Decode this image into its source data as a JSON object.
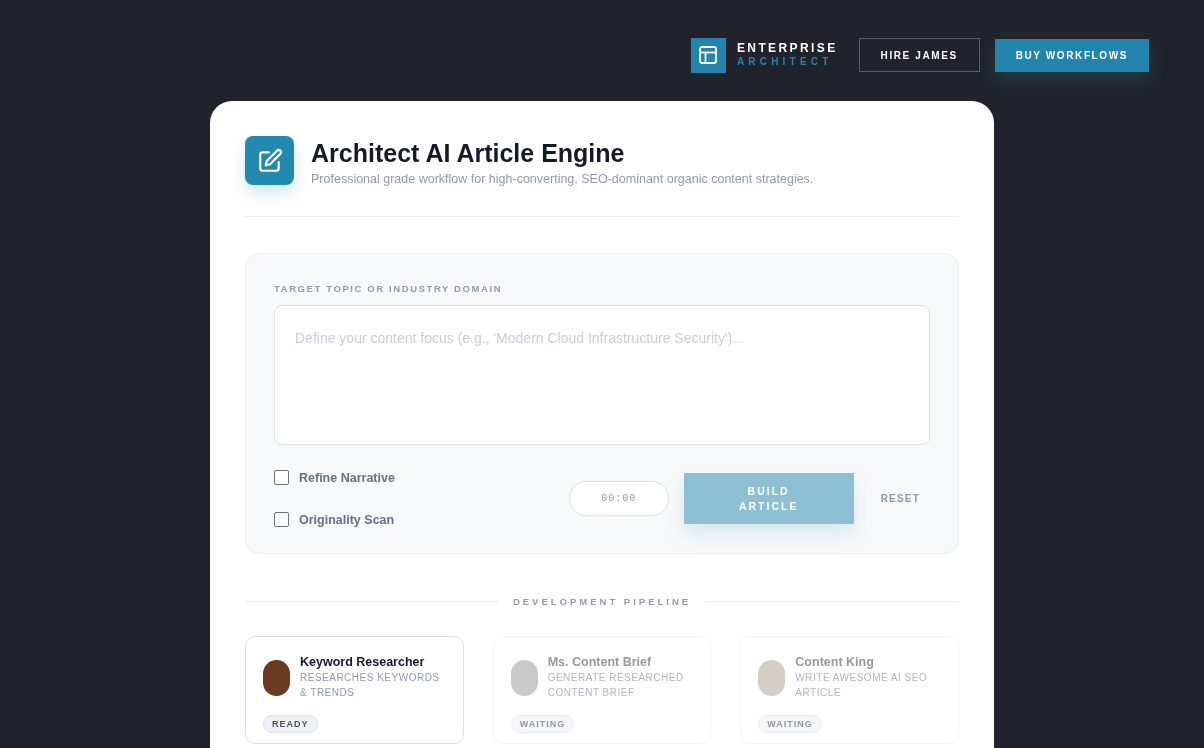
{
  "brand": {
    "title": "ENTERPRISE",
    "subtitle": "ARCHITECT"
  },
  "nav_buttons": [
    {
      "label": "HIRE JAMES",
      "kind": "outline"
    },
    {
      "label": "BUY WORKFLOWS",
      "kind": "primary"
    }
  ],
  "header": {
    "title": "Architect AI Article Engine",
    "subtitle": "Professional grade workflow for high-converting, SEO-dominant organic content strategies."
  },
  "form": {
    "label": "TARGET TOPIC OR INDUSTRY DOMAIN",
    "placeholder": "Define your content focus (e.g., 'Modern Cloud Infrastructure Security')...",
    "options": [
      {
        "label": "Refine Narrative",
        "checked": false
      },
      {
        "label": "Originality Scan",
        "checked": false
      }
    ],
    "timer": "00:00",
    "build_button": {
      "label": "BUILD ARTICLE",
      "disabled": true
    },
    "reset_label": "RESET"
  },
  "pipeline": {
    "title": "DEVELOPMENT PIPELINE",
    "agents": [
      {
        "name": "Keyword Researcher",
        "description": "RESEARCHES KEYWORDS & TRENDS",
        "status": "READY",
        "active": true
      },
      {
        "name": "Ms. Content Brief",
        "description": "GENERATE RESEARCHED CONTENT BRIEF",
        "status": "WAITING",
        "active": false
      },
      {
        "name": "Content King",
        "description": "WRITE AWESOME AI SEO ARTICLE",
        "status": "WAITING",
        "active": false
      }
    ]
  }
}
